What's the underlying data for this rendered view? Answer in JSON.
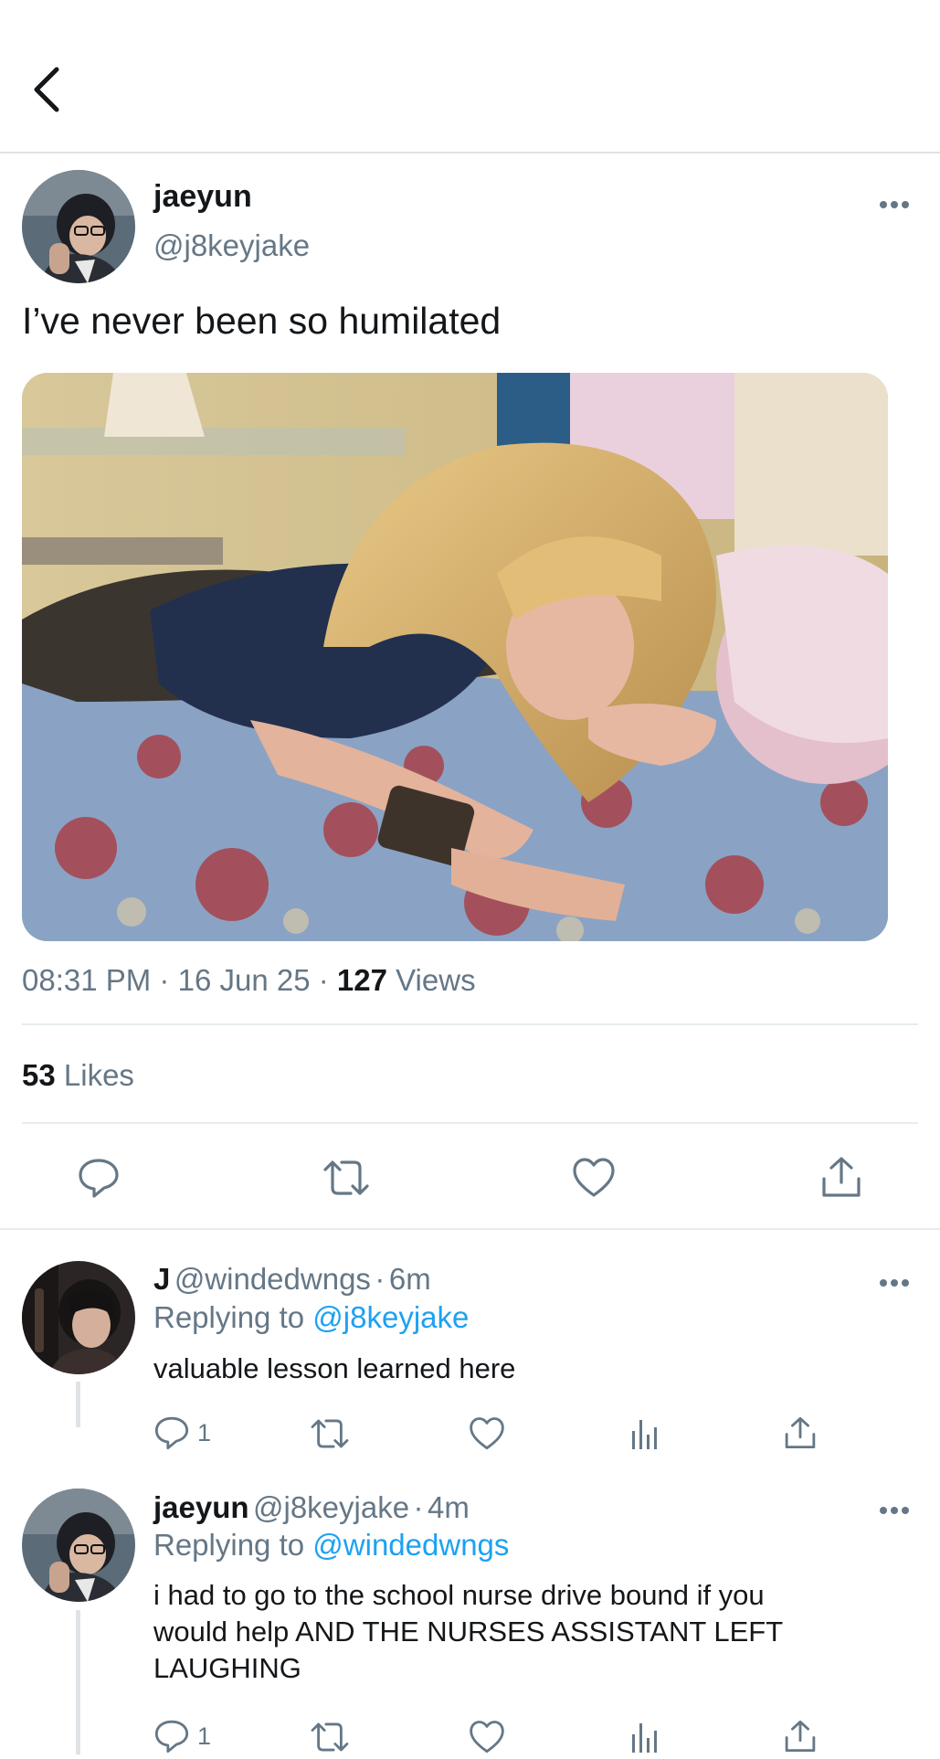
{
  "colors": {
    "accent": "#1da1f2",
    "secondary_text": "#657786",
    "divider": "#e6ecf0"
  },
  "header": {
    "back_icon": "chevron-left-icon"
  },
  "tweet": {
    "name": "jaeyun",
    "handle": "@j8keyjake",
    "text": "I’ve never been so humilated",
    "time": "08:31 PM",
    "sep1": "·",
    "date": "16 Jun 25",
    "sep2": "·",
    "views_count": "127",
    "views_label": "Views",
    "likes_count": "53",
    "likes_label": "Likes",
    "more_icon": "more-dots-icon",
    "actions": [
      "reply-icon",
      "retweet-icon",
      "like-icon",
      "share-icon"
    ]
  },
  "replies": [
    {
      "name": "J",
      "handle": "@windedwngs",
      "sep": "·",
      "age": "6m",
      "replying_prefix": "Replying to",
      "replying_to": "@j8keyjake",
      "text": "valuable lesson learned here",
      "reply_count": "1"
    },
    {
      "name": "jaeyun",
      "handle": "@j8keyjake",
      "sep": "·",
      "age": "4m",
      "replying_prefix": "Replying to",
      "replying_to": "@windedwngs",
      "text_line1": "i had to go to the school nurse drive bound if you",
      "text_line2": "would help AND THE NURSES ASSISTANT LEFT",
      "text_line3": "LAUGHING",
      "reply_count": "1"
    }
  ]
}
